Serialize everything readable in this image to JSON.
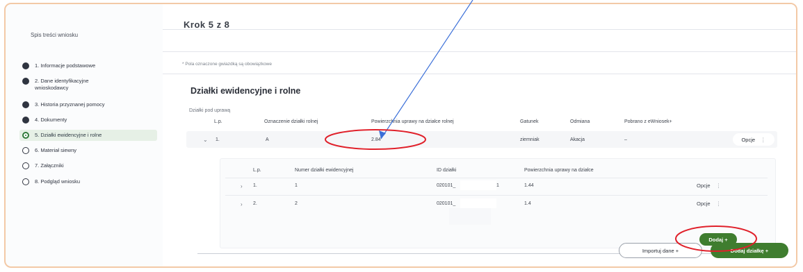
{
  "sidebar": {
    "title": "Spis treści wniosku",
    "steps": [
      {
        "label": "1. Informacje podstawowe",
        "state": "done"
      },
      {
        "label": "2. Dane identyfikacyjne wnioskodawcy",
        "state": "done"
      },
      {
        "label": "3. Historia przyznanej pomocy",
        "state": "done"
      },
      {
        "label": "4. Dokumenty",
        "state": "done"
      },
      {
        "label": "5. Działki ewidencyjne i rolne",
        "state": "active"
      },
      {
        "label": "6. Materiał siewny",
        "state": "todo"
      },
      {
        "label": "7. Załączniki",
        "state": "todo"
      },
      {
        "label": "8. Podgląd wniosku",
        "state": "todo"
      }
    ]
  },
  "main": {
    "step_title": "Krok 5 z 8",
    "required_note": "* Pola oznaczone gwiazdką są obowiązkowe",
    "section_title": "Działki ewidencyjne i rolne",
    "sub_label": "Działki pod uprawą",
    "table": {
      "headers": [
        "L.p.",
        "Oznaczenie działki rolnej",
        "Powierzchnia uprawy na działce rolnej",
        "Gatunek",
        "Odmiana",
        "Pobrano z eWniosek+"
      ],
      "row": {
        "lp": "1.",
        "oznaczenie": "A",
        "powierzchnia": "2.84",
        "gatunek": "ziemniak",
        "odmiana": "Akacja",
        "pobrano": "–",
        "options_label": "Opcje"
      }
    },
    "nested_table": {
      "headers": [
        "L.p.",
        "Numer działki ewidencyjnej",
        "ID działki",
        "Powierzchnia uprawy na działce"
      ],
      "rows": [
        {
          "lp": "1.",
          "numer": "1",
          "id": "020101_",
          "id_suffix": "1",
          "powierzchnia": "1.44",
          "options_label": "Opcje"
        },
        {
          "lp": "2.",
          "numer": "2",
          "id": "020101_",
          "id_suffix": "",
          "powierzchnia": "1.4",
          "options_label": "Opcje"
        }
      ],
      "add_button": "Dodaj +"
    },
    "import_button": "Importuj dane +",
    "add_plot_button": "Dodaj działkę +"
  },
  "annotations": {
    "arrow_color": "#3b6fd8",
    "circle_color": "#e0202a"
  }
}
